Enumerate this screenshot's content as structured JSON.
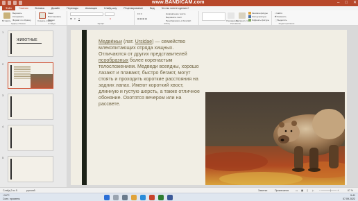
{
  "watermark": "www.BANDICAM.com",
  "ribbon": {
    "tabs": [
      "Файл",
      "Главная",
      "Вставка",
      "Дизайн",
      "Переходы",
      "Анимация",
      "Слайд-шоу",
      "Рецензирование",
      "Вид",
      "Что вы хотите сделать?"
    ],
    "active_tab_index": 1,
    "groups": {
      "clipboard": "Буфер обмена",
      "slides": "Слайды",
      "font": "Шрифт",
      "paragraph": "Абзац",
      "drawing": "Рисование",
      "editing": "Редактирование"
    },
    "buttons": {
      "paste": "Вставить",
      "cut": "Вырезать",
      "copy": "Копировать",
      "format": "Формат по образцу",
      "new_slide": "Создать слайд",
      "layout": "Макет",
      "reset": "Восстановить",
      "section": "Раздел",
      "arrange": "Упорядочить",
      "quick_styles": "Экспресс-стили",
      "find": "Найти",
      "replace": "Заменить",
      "select": "Выделить",
      "shape_fill": "Заливка фигуры",
      "shape_outline": "Контур фигуры",
      "shape_effects": "Эффекты фигуры",
      "text_direction": "Направление текста",
      "align_text": "Выровнять текст",
      "smartart": "Преобразовать в SmartArt"
    }
  },
  "thumbnails": [
    {
      "num": "1",
      "title": "ЖИВОТНЫЕ"
    },
    {
      "num": "2",
      "title": ""
    },
    {
      "num": "3",
      "title": ""
    },
    {
      "num": "4",
      "title": ""
    },
    {
      "num": "5",
      "title": ""
    }
  ],
  "slide": {
    "word1": "Медве́жьи",
    "paren_open": " (лат. ",
    "latin": "Ursidae",
    "after_latin": ") — семейство млекопитающих отряда хищных. Отличаются от других представителей ",
    "word2": "псообразных",
    "rest": " более коренастым телосложением. Медведи всеядны, хорошо лазают и плавают, быстро бегают, могут стоять и проходить короткие расстояния на задних лапах. Имеют короткий хвост, длинную и густую шерсть, а также отличное обоняние. Охотятся вечером или на рассвете."
  },
  "status": {
    "slide_info": "Слайд 2 из 5",
    "language": "русский",
    "notes": "Заметки",
    "comments": "Примечания",
    "zoom": "67 %"
  },
  "taskbar": {
    "weather_temp": "+16°С",
    "weather_desc": "Солн. просветы",
    "time": "9:41",
    "date": "07.09.2022"
  },
  "colors": {
    "accent": "#b7472a",
    "slide_bg": "#f1eee4",
    "text": "#6e6240"
  }
}
